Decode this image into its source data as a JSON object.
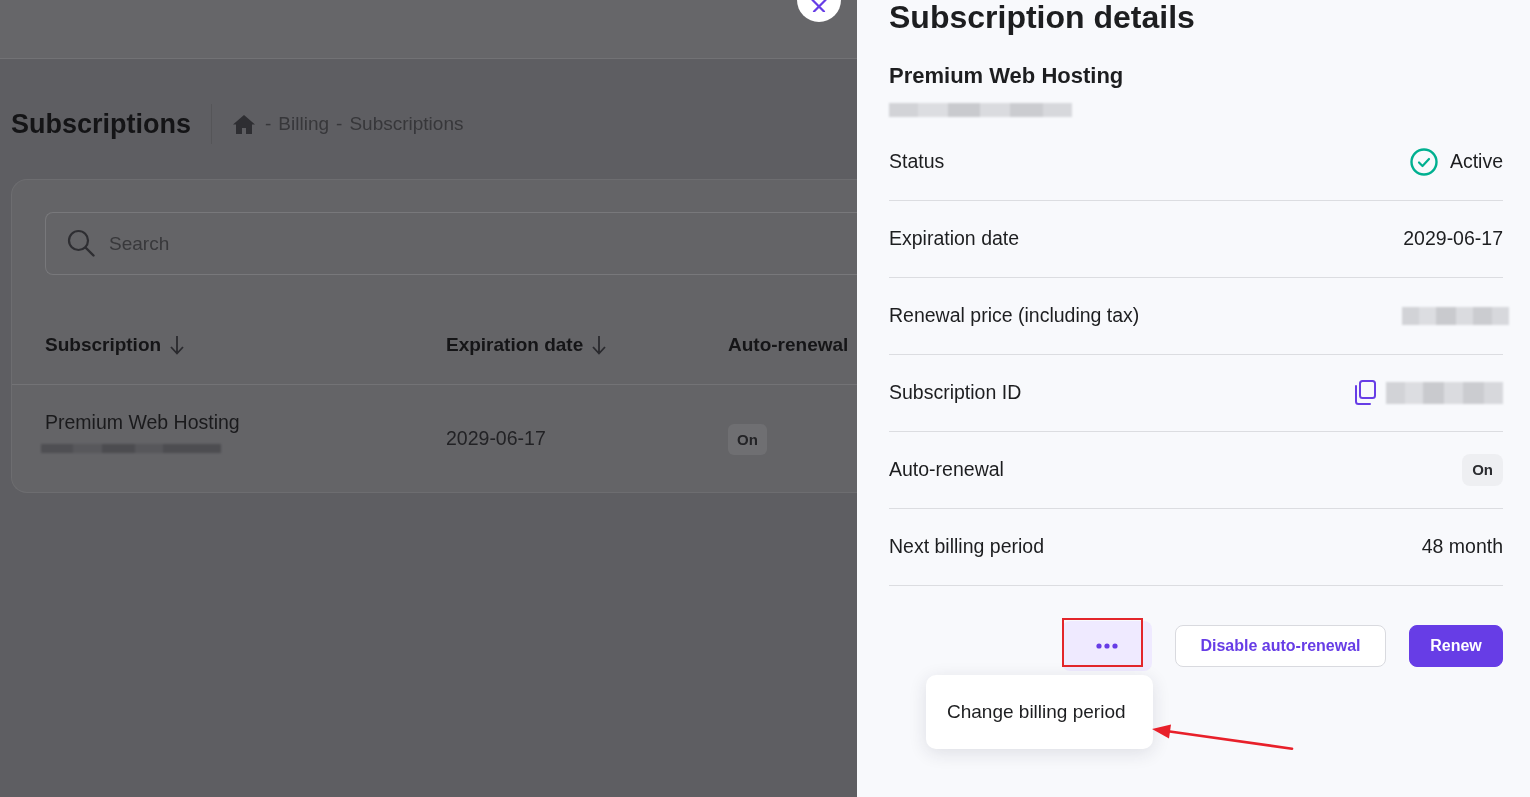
{
  "background_page": {
    "title": "Subscriptions",
    "breadcrumb": {
      "separator": "-",
      "items": [
        "Billing",
        "Subscriptions"
      ]
    },
    "search": {
      "placeholder": "Search"
    },
    "table": {
      "columns": [
        {
          "label": "Subscription",
          "sort_icon": true
        },
        {
          "label": "Expiration date",
          "sort_icon": true
        },
        {
          "label": "Auto-renewal",
          "sort_icon": false
        }
      ],
      "rows": [
        {
          "cells": [
            {
              "kind": "product",
              "text": "Premium Web Hosting"
            },
            {
              "kind": "text",
              "text": "2029-06-17"
            },
            {
              "kind": "badge",
              "text": "On"
            }
          ]
        }
      ]
    }
  },
  "panel": {
    "title": "Subscription details",
    "product": "Premium Web Hosting",
    "details": [
      {
        "kind": "status",
        "label": "Status",
        "value": "Active"
      },
      {
        "kind": "text",
        "label": "Expiration date",
        "value": "2029-06-17"
      },
      {
        "kind": "redacted",
        "label": "Renewal price (including tax)"
      },
      {
        "kind": "copy_id",
        "label": "Subscription ID"
      },
      {
        "kind": "badge",
        "label": "Auto-renewal",
        "value": "On"
      },
      {
        "kind": "text",
        "label": "Next billing period",
        "value": "48 month"
      }
    ],
    "actions": {
      "more": {
        "expanded": true,
        "menu": [
          "Change billing period"
        ]
      },
      "buttons": [
        {
          "kind": "outline",
          "label": "Disable auto-renewal"
        },
        {
          "kind": "primary",
          "label": "Renew"
        }
      ]
    }
  }
}
